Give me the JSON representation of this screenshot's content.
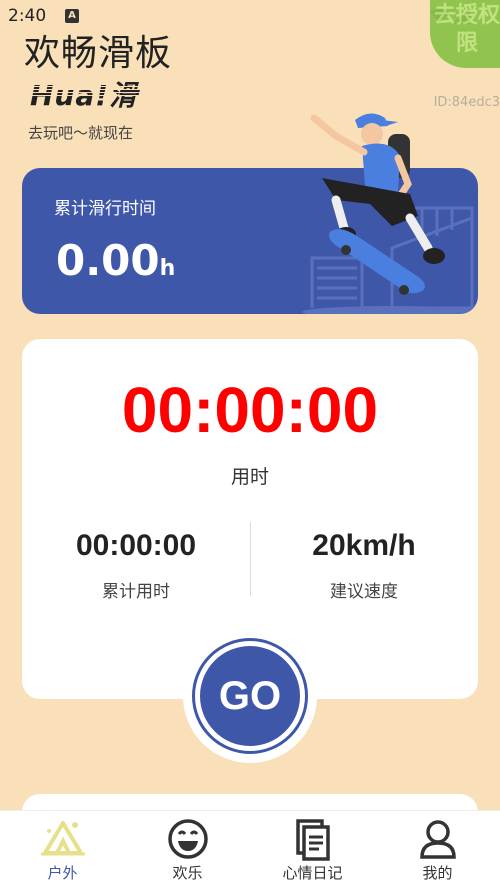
{
  "status": {
    "time": "2:40",
    "a_badge": "A"
  },
  "header": {
    "title": "欢畅滑板",
    "logo": "Hua!滑",
    "tagline": "去玩吧～就现在",
    "device_id": "ID:84edc3",
    "permission_badge": "去授权限"
  },
  "hero": {
    "label": "累计滑行时间",
    "value": "0.00",
    "unit": "h"
  },
  "timer": {
    "main": "00:00:00",
    "caption": "用时",
    "stats": [
      {
        "value": "00:00:00",
        "label": "累计用时"
      },
      {
        "value": "20km/h",
        "label": "建议速度"
      }
    ],
    "go_label": "GO"
  },
  "tabs": [
    {
      "label": "户外",
      "icon": "camp-icon",
      "active": true
    },
    {
      "label": "欢乐",
      "icon": "smile-icon",
      "active": false
    },
    {
      "label": "心情日记",
      "icon": "journal-icon",
      "active": false
    },
    {
      "label": "我的",
      "icon": "user-icon",
      "active": false
    }
  ],
  "colors": {
    "background": "#f9e0b9",
    "accent": "#3f57a9",
    "timer": "#ff0000",
    "badge": "#8bc34a"
  }
}
